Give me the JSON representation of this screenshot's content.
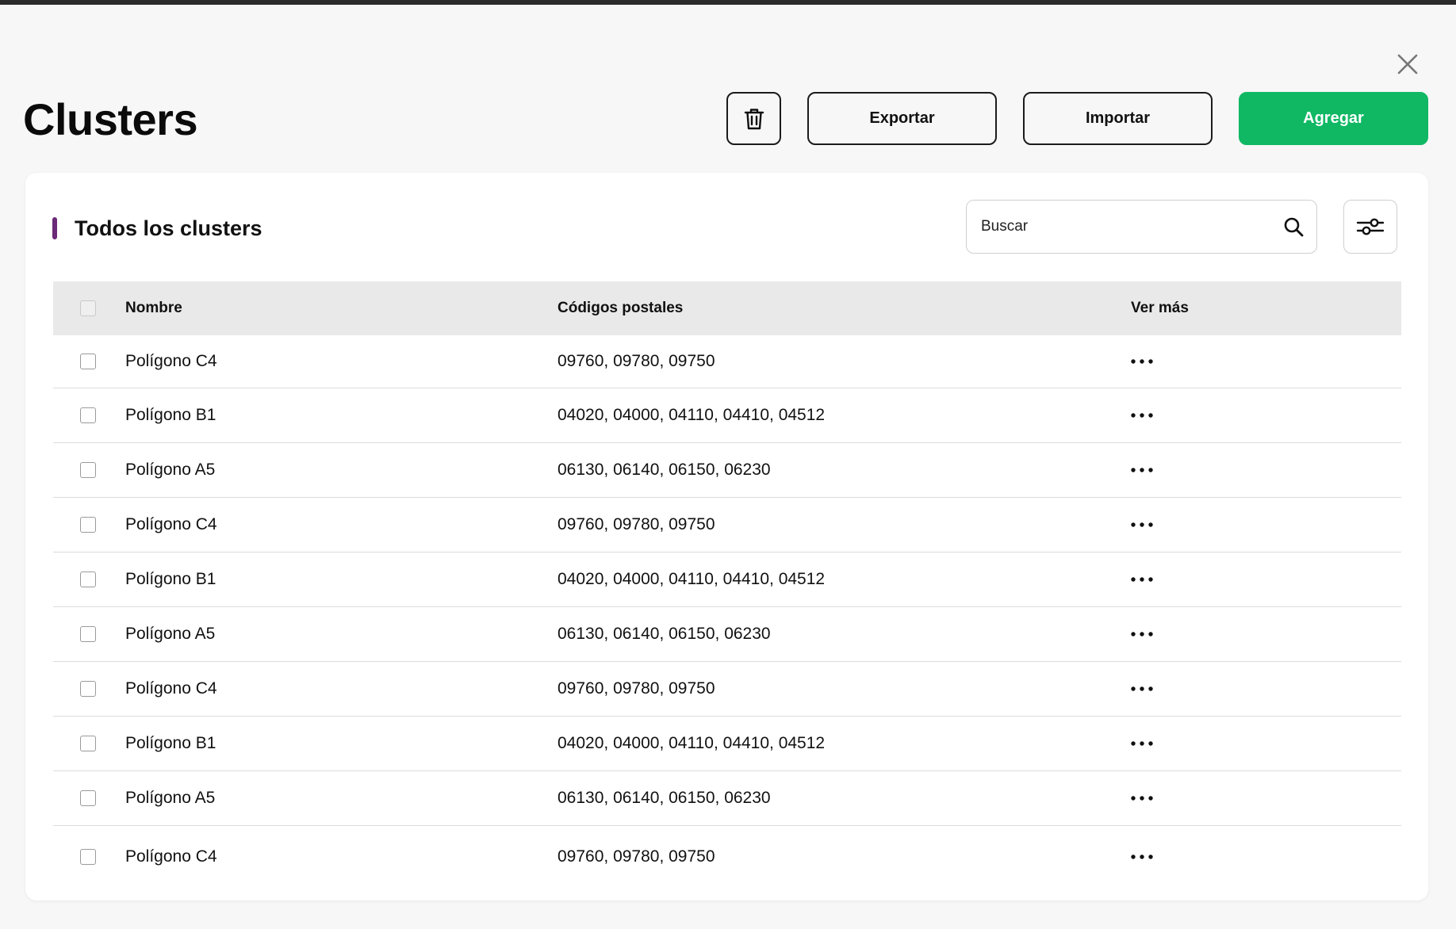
{
  "header": {
    "title": "Clusters",
    "export_label": "Exportar",
    "import_label": "Importar",
    "add_label": "Agregar",
    "add_color": "#10b864"
  },
  "card": {
    "title": "Todos los clusters",
    "accent_color": "#6b2a78"
  },
  "search": {
    "placeholder": "Buscar"
  },
  "icons": {
    "close": "close-icon",
    "delete": "trash-icon",
    "search": "search-icon",
    "filter": "sliders-icon",
    "more": "more-horizontal-icon"
  },
  "table": {
    "columns": [
      "Nombre",
      "Códigos postales",
      "Ver más"
    ],
    "rows": [
      {
        "name": "Polígono C4",
        "codes": "09760, 09780, 09750"
      },
      {
        "name": "Polígono B1",
        "codes": "04020, 04000, 04110, 04410, 04512"
      },
      {
        "name": "Polígono A5",
        "codes": "06130, 06140, 06150, 06230"
      },
      {
        "name": "Polígono C4",
        "codes": "09760, 09780, 09750"
      },
      {
        "name": "Polígono B1",
        "codes": "04020, 04000, 04110, 04410, 04512"
      },
      {
        "name": "Polígono A5",
        "codes": "06130, 06140, 06150, 06230"
      },
      {
        "name": "Polígono C4",
        "codes": "09760, 09780, 09750"
      },
      {
        "name": "Polígono B1",
        "codes": "04020, 04000, 04110, 04410, 04512"
      },
      {
        "name": "Polígono A5",
        "codes": "06130, 06140, 06150, 06230"
      },
      {
        "name": "Polígono C4",
        "codes": "09760, 09780, 09750"
      }
    ]
  }
}
